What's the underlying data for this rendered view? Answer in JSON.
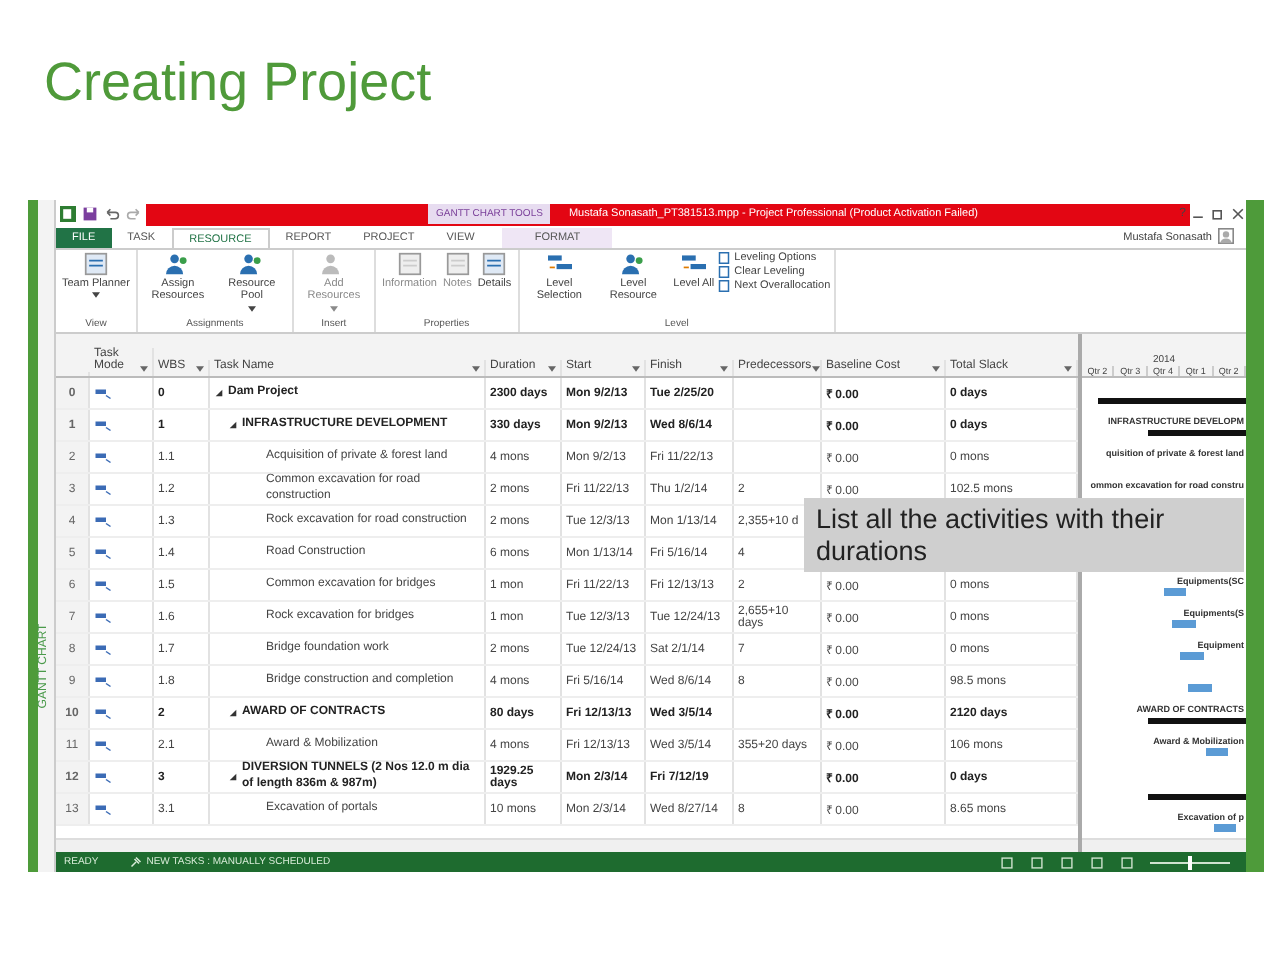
{
  "slide_title": "Creating Project",
  "window": {
    "title": "Mustafa Sonasath_PT381513.mpp - Project Professional (Product Activation Failed)",
    "context_tab": "GANTT CHART TOOLS",
    "help": "?",
    "user": "Mustafa Sonasath"
  },
  "tabs": [
    {
      "label": "FILE",
      "selected": false,
      "kind": "file"
    },
    {
      "label": "TASK",
      "selected": false,
      "kind": "tab"
    },
    {
      "label": "RESOURCE",
      "selected": true,
      "kind": "tab"
    },
    {
      "label": "REPORT",
      "selected": false,
      "kind": "tab"
    },
    {
      "label": "PROJECT",
      "selected": false,
      "kind": "tab"
    },
    {
      "label": "VIEW",
      "selected": false,
      "kind": "tab"
    },
    {
      "label": "FORMAT",
      "selected": false,
      "kind": "context"
    }
  ],
  "ribbon_groups": [
    {
      "name": "View",
      "buttons": [
        {
          "label": "Team Planner",
          "dropdown": true,
          "disabled": false
        }
      ]
    },
    {
      "name": "Assignments",
      "buttons": [
        {
          "label": "Assign Resources",
          "dropdown": false,
          "disabled": false
        },
        {
          "label": "Resource Pool",
          "dropdown": true,
          "disabled": false
        }
      ]
    },
    {
      "name": "Insert",
      "buttons": [
        {
          "label": "Add Resources",
          "dropdown": true,
          "disabled": true
        }
      ]
    },
    {
      "name": "Properties",
      "buttons": [
        {
          "label": "Information",
          "dropdown": false,
          "disabled": true
        },
        {
          "label": "Notes",
          "dropdown": false,
          "disabled": true
        },
        {
          "label": "Details",
          "dropdown": false,
          "disabled": false
        }
      ]
    },
    {
      "name": "Level",
      "buttons": [
        {
          "label": "Level Selection",
          "dropdown": false,
          "disabled": false
        },
        {
          "label": "Level Resource",
          "dropdown": false,
          "disabled": false
        },
        {
          "label": "Level All",
          "dropdown": false,
          "disabled": false
        }
      ],
      "small_buttons": [
        "Leveling Options",
        "Clear Leveling",
        "Next Overallocation"
      ]
    }
  ],
  "side_label": "GANTT CHART",
  "columns": [
    "Task Mode",
    "WBS",
    "Task Name",
    "Duration",
    "Start",
    "Finish",
    "Predecessors",
    "Baseline Cost",
    "Total Slack"
  ],
  "gantt_header": {
    "year": "2014",
    "quarters": [
      "Qtr 2",
      "Qtr 3",
      "Qtr 4",
      "Qtr 1",
      "Qtr 2"
    ]
  },
  "tasks": [
    {
      "id": "0",
      "wbs": "0",
      "name": "Dam Project",
      "summary": true,
      "expanded": true,
      "duration": "2300 days",
      "start": "Mon 9/2/13",
      "finish": "Tue 2/25/20",
      "baseline_cost": "₹ 0.00",
      "total_slack": "0 days",
      "gantt_bar": true,
      "children": [
        {
          "id": "1",
          "wbs": "1",
          "name": "INFRASTRUCTURE DEVELOPMENT",
          "summary": true,
          "expanded": true,
          "duration": "330 days",
          "start": "Mon 9/2/13",
          "finish": "Wed 8/6/14",
          "baseline_cost": "₹ 0.00",
          "total_slack": "0 days",
          "gantt_bar": true,
          "gantt_label": "INFRASTRUCTURE DEVELOPM",
          "children": [
            {
              "id": "2",
              "wbs": "1.1",
              "name": "Acquisition of private & forest land",
              "summary": false,
              "duration": "4 mons",
              "start": "Mon 9/2/13",
              "finish": "Fri 11/22/13",
              "baseline_cost": "₹ 0.00",
              "total_slack": "0 mons",
              "gantt_bar": false,
              "gantt_label": "quisition of private & forest land"
            },
            {
              "id": "3",
              "wbs": "1.2",
              "name": "Common excavation for road construction",
              "summary": false,
              "duration": "2 mons",
              "start": "Fri 11/22/13",
              "finish": "Thu 1/2/14",
              "predecessors": "2",
              "baseline_cost": "₹ 0.00",
              "total_slack": "102.5 mons",
              "gantt_bar": false,
              "gantt_label": "ommon excavation for road constru"
            },
            {
              "id": "4",
              "wbs": "1.3",
              "name": "Rock excavation for road construction",
              "summary": false,
              "duration": "2 mons",
              "start": "Tue 12/3/13",
              "finish": "Mon 1/13/14",
              "predecessors": "2,355+10 d",
              "gantt_bar": false
            },
            {
              "id": "5",
              "wbs": "1.4",
              "name": "Road Construction",
              "summary": false,
              "duration": "6 mons",
              "start": "Mon 1/13/14",
              "finish": "Fri 5/16/14",
              "predecessors": "4",
              "gantt_bar": false
            },
            {
              "id": "6",
              "wbs": "1.5",
              "name": "Common excavation for bridges",
              "summary": false,
              "duration": "1 mon",
              "start": "Fri 11/22/13",
              "finish": "Fri 12/13/13",
              "predecessors": "2",
              "baseline_cost": "₹ 0.00",
              "total_slack": "0 mons",
              "gantt_bar": true,
              "gantt_label": "Equipments(SC"
            },
            {
              "id": "7",
              "wbs": "1.6",
              "name": "Rock excavation for bridges",
              "summary": false,
              "duration": "1 mon",
              "start": "Tue 12/3/13",
              "finish": "Tue 12/24/13",
              "predecessors": "2,655+10 days",
              "baseline_cost": "₹ 0.00",
              "total_slack": "0 mons",
              "gantt_bar": true,
              "gantt_label": "Equipments(S"
            },
            {
              "id": "8",
              "wbs": "1.7",
              "name": "Bridge foundation work",
              "summary": false,
              "duration": "2 mons",
              "start": "Tue 12/24/13",
              "finish": "Sat 2/1/14",
              "predecessors": "7",
              "baseline_cost": "₹ 0.00",
              "total_slack": "0 mons",
              "gantt_bar": true,
              "gantt_label": "Equipment"
            },
            {
              "id": "9",
              "wbs": "1.8",
              "name": "Bridge construction and completion",
              "summary": false,
              "duration": "4 mons",
              "start": "Fri 5/16/14",
              "finish": "Wed 8/6/14",
              "predecessors": "8",
              "baseline_cost": "₹ 0.00",
              "total_slack": "98.5 mons",
              "gantt_bar": true
            }
          ]
        },
        {
          "id": "10",
          "wbs": "2",
          "name": "AWARD OF CONTRACTS",
          "summary": true,
          "expanded": true,
          "duration": "80 days",
          "start": "Fri 12/13/13",
          "finish": "Wed 3/5/14",
          "baseline_cost": "₹ 0.00",
          "total_slack": "2120 days",
          "gantt_bar": true,
          "gantt_label": "AWARD OF CONTRACTS",
          "children": [
            {
              "id": "11",
              "wbs": "2.1",
              "name": "Award & Mobilization",
              "summary": false,
              "duration": "4 mons",
              "start": "Fri 12/13/13",
              "finish": "Wed 3/5/14",
              "predecessors": "355+20 days",
              "baseline_cost": "₹ 0.00",
              "total_slack": "106 mons",
              "gantt_bar": true,
              "gantt_label": "Award & Mobilization"
            }
          ]
        },
        {
          "id": "12",
          "wbs": "3",
          "name": "DIVERSION TUNNELS (2 Nos 12.0 m dia of length 836m & 987m)",
          "summary": true,
          "expanded": true,
          "duration": "1929.25 days",
          "start": "Mon 2/3/14",
          "finish": "Fri 7/12/19",
          "baseline_cost": "₹ 0.00",
          "total_slack": "0 days",
          "gantt_bar": true,
          "children": [
            {
              "id": "13",
              "wbs": "3.1",
              "name": "Excavation of portals",
              "summary": false,
              "duration": "10 mons",
              "start": "Mon 2/3/14",
              "finish": "Wed 8/27/14",
              "predecessors": "8",
              "baseline_cost": "₹ 0.00",
              "total_slack": "8.65 mons",
              "gantt_bar": true,
              "gantt_label": "Excavation of p"
            }
          ]
        }
      ]
    }
  ],
  "callout": "List all the activities with their durations",
  "status_bar": {
    "mode": "READY",
    "new_tasks": "NEW TASKS : MANUALLY SCHEDULED",
    "zoom": {
      "level": 0.5
    }
  }
}
